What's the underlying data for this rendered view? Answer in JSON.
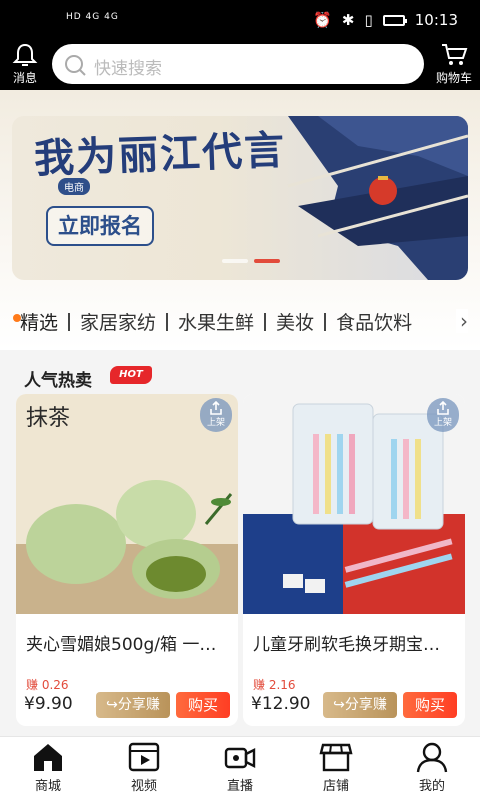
{
  "status_bar": {
    "left_text": "HD 4G 4G",
    "time": "10:13"
  },
  "header": {
    "message_label": "消息",
    "search_placeholder": "快速搜索",
    "cart_label": "购物车"
  },
  "banner": {
    "title": "我为丽江代言",
    "tag": "电商",
    "cta": "立即报名"
  },
  "tabs": [
    {
      "label": "精选",
      "active": true
    },
    {
      "label": "家居家纺"
    },
    {
      "label": "水果生鲜"
    },
    {
      "label": "美妆"
    },
    {
      "label": "食品饮料"
    }
  ],
  "section": {
    "title": "人气热卖",
    "badge": "HOT"
  },
  "products": [
    {
      "image_text": "抹茶",
      "name": "夹心雪媚娘500g/箱 一…",
      "earn": "赚 0.26",
      "price": "¥9.90",
      "share_label": "分享赚",
      "buy_label": "购买",
      "shelf_label": "上架"
    },
    {
      "image_text": "",
      "name": "儿童牙刷软毛换牙期宝…",
      "earn": "赚 2.16",
      "price": "¥12.90",
      "share_label": "分享赚",
      "buy_label": "购买",
      "shelf_label": "上架"
    }
  ],
  "bottom_nav": [
    {
      "label": "商城",
      "icon": "home-icon",
      "active": true
    },
    {
      "label": "视频",
      "icon": "video-icon"
    },
    {
      "label": "直播",
      "icon": "camera-icon"
    },
    {
      "label": "店铺",
      "icon": "store-icon"
    },
    {
      "label": "我的",
      "icon": "user-icon"
    }
  ]
}
